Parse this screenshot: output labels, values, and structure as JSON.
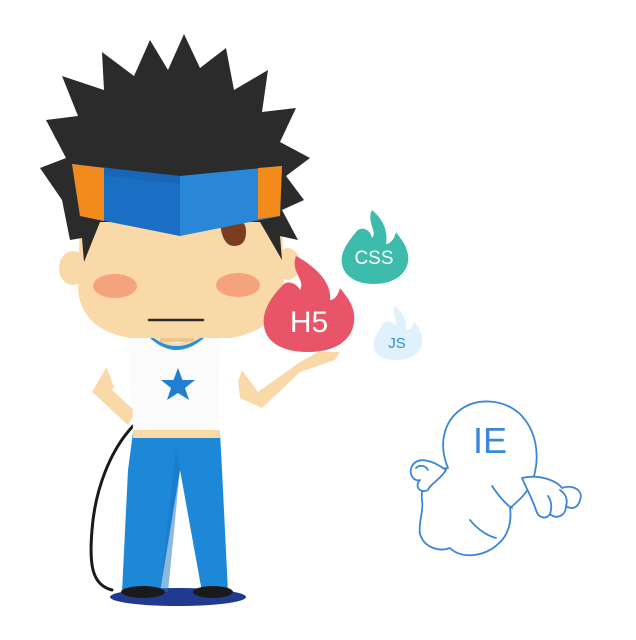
{
  "illustration": {
    "flames": [
      {
        "label": "CSS",
        "color": "#3ebcab"
      },
      {
        "label": "H5",
        "color": "#e85468"
      },
      {
        "label": "JS",
        "color": "#dff2fb",
        "text_color": "#2d8fd4"
      }
    ],
    "ie_ghost": {
      "label": "IE",
      "color": "#3a86d8"
    },
    "colors": {
      "hair": "#2b2b2b",
      "headband_blue": "#1a6fc4",
      "headband_orange": "#f28a1c",
      "skin": "#f9d9a8",
      "cheeks": "#f4a37c",
      "shirt": "#ffffff",
      "collar": "#2d8fd4",
      "star": "#1f7fd0",
      "pants": "#1e88d8",
      "shadow": "#213a8f"
    }
  }
}
